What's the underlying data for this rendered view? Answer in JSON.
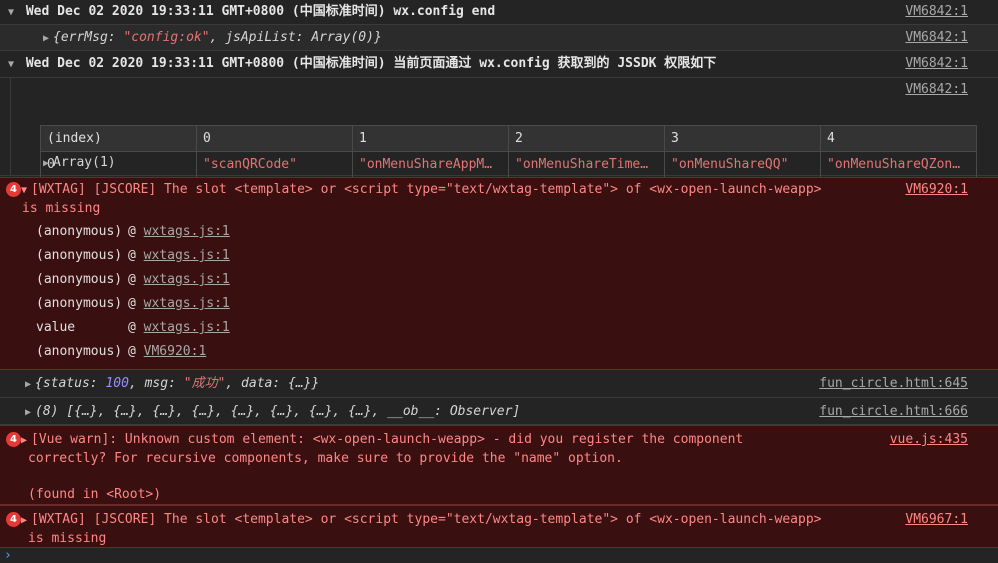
{
  "log1": {
    "text": "Wed Dec 02 2020 19:33:11 GMT+0800 (中国标准时间) wx.config end",
    "source": "VM6842:1"
  },
  "log1_obj": {
    "key1": "errMsg",
    "val1": "\"config:ok\"",
    "key2": "jsApiList",
    "val2": "Array(0)",
    "source": "VM6842:1"
  },
  "log2": {
    "text": "Wed Dec 02 2020 19:33:11 GMT+0800 (中国标准时间) 当前页面通过 wx.config 获取到的 JSSDK 权限如下",
    "source": "VM6842:1",
    "source2": "VM6842:1"
  },
  "table": {
    "headers": [
      "(index)",
      "0",
      "1",
      "2",
      "3",
      "4"
    ],
    "row": [
      "0",
      "\"scanQRCode\"",
      "\"onMenuShareAppM…",
      "\"onMenuShareTime…",
      "\"onMenuShareQQ\"",
      "\"onMenuShareQZon…"
    ],
    "array_label": "Array(1)"
  },
  "error1": {
    "count": "4",
    "line1": "[WXTAG] [JSCORE] The slot <template> or <script type=\"text/wxtag-template\"> of <wx-open-launch-weapp>",
    "line2": "is missing",
    "source": "VM6920:1",
    "stack": [
      {
        "fn": "(anonymous)",
        "file": "wxtags.js:1"
      },
      {
        "fn": "(anonymous)",
        "file": "wxtags.js:1"
      },
      {
        "fn": "(anonymous)",
        "file": "wxtags.js:1"
      },
      {
        "fn": "(anonymous)",
        "file": "wxtags.js:1"
      },
      {
        "fn": "value",
        "file": "wxtags.js:1"
      },
      {
        "fn": "(anonymous)",
        "file": "VM6920:1"
      }
    ]
  },
  "log3": {
    "k1": "status",
    "v1": "100",
    "k2": "msg",
    "v2": "\"成功\"",
    "k3": "data",
    "v3": "{…}",
    "source": "fun_circle.html:645"
  },
  "log4": {
    "text": "(8) [{…}, {…}, {…}, {…}, {…}, {…}, {…}, {…}, __ob__: Observer]",
    "source": "fun_circle.html:666"
  },
  "error2": {
    "count": "4",
    "line1": "[Vue warn]: Unknown custom element: <wx-open-launch-weapp> - did you register the component",
    "line2": "correctly? For recursive components, make sure to provide the \"name\" option.",
    "line3": "(found in <Root>)",
    "source": "vue.js:435"
  },
  "error3": {
    "count": "4",
    "line1": "[WXTAG] [JSCORE] The slot <template> or <script type=\"text/wxtag-template\"> of <wx-open-launch-weapp>",
    "line2": "is missing",
    "source": "VM6967:1"
  },
  "prompt": {
    "symbol": "›"
  },
  "colors": {
    "background": "#242424",
    "error_bg": "#3a0f10",
    "error_text": "#ff8686",
    "string": "#e57373",
    "number": "#9b8cff",
    "badge": "#e53935"
  }
}
